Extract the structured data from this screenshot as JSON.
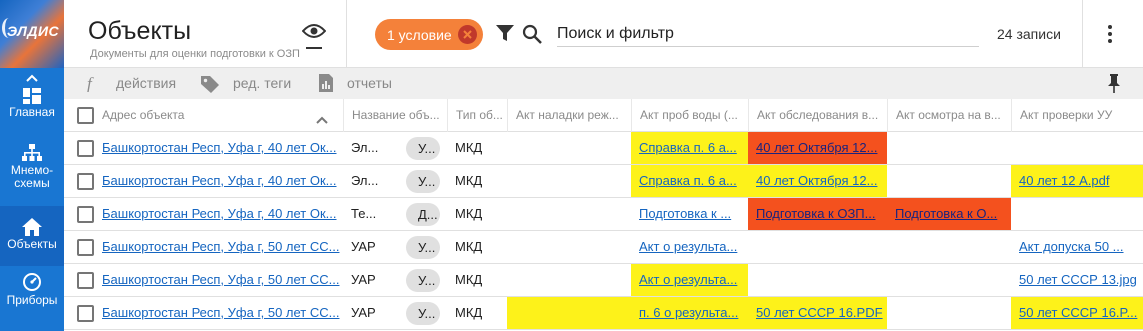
{
  "logo": {
    "text": "ЭЛДИС"
  },
  "rail": {
    "items": [
      {
        "label": "Главная",
        "icon": "dashboard-icon"
      },
      {
        "label": "Мнемо-",
        "label2": "схемы",
        "icon": "hierarchy-icon"
      },
      {
        "label": "Объекты",
        "icon": "home-icon",
        "active": true
      },
      {
        "label": "Приборы",
        "icon": "gauge-icon"
      }
    ]
  },
  "header": {
    "title": "Объекты",
    "subtitle": "Документы для оценки подготовки к ОЗП",
    "filter_chip": "1 условие",
    "search_placeholder": "Поиск и фильтр",
    "records": "24 записи"
  },
  "toolbar": {
    "actions": "действия",
    "tags": "ред. теги",
    "reports": "отчеты"
  },
  "table": {
    "columns": [
      "Адрес объекта",
      "Название объ...",
      "Тип об...",
      "Акт наладки реж...",
      "Акт проб воды (...",
      "Акт обследования в...",
      "Акт осмотра на в...",
      "Акт проверки УУ"
    ],
    "rows": [
      {
        "address": "Башкортостан Респ, Уфа г, 40 лет Ок...",
        "name": "Эл...",
        "pill": "У...",
        "type": "МКД",
        "c4": "",
        "c5": "Справка п. 6 а...",
        "c6": "40 лет Октября 12...",
        "c7": "",
        "c8": ""
      },
      {
        "address": "Башкортостан Респ, Уфа г, 40 лет Ок...",
        "name": "Эл...",
        "pill": "У...",
        "type": "МКД",
        "c4": "",
        "c5": "Справка п. 6 а...",
        "c6": "40 лет Октября 12...",
        "c7": "",
        "c8": "40 лет 12 А.pdf"
      },
      {
        "address": "Башкортостан Респ, Уфа г, 40 лет Ок...",
        "name": "Те...",
        "pill": "Д...",
        "type": "МКД",
        "c4": "",
        "c5": "Подготовка к ...",
        "c6": "Подготовка к ОЗП...",
        "c7": "Подготовка к О...",
        "c8": ""
      },
      {
        "address": "Башкортостан Респ, Уфа г, 50 лет СС...",
        "name": "УАР",
        "pill": "У...",
        "type": "МКД",
        "c4": "",
        "c5": "Акт о результа...",
        "c6": "",
        "c7": "",
        "c8": "Акт допуска 50 ..."
      },
      {
        "address": "Башкортостан Респ, Уфа г, 50 лет СС...",
        "name": "УАР",
        "pill": "У...",
        "type": "МКД",
        "c4": "",
        "c5": "Акт о результа...",
        "c6": "",
        "c7": "",
        "c8": "50 лет СССР 13.jpg"
      },
      {
        "address": "Башкортостан Респ, Уфа г, 50 лет СС...",
        "name": "УАР",
        "pill": "У...",
        "type": "МКД",
        "c4": "",
        "c5": "п. 6 о результа...",
        "c6": "50 лет СССР 16.PDF",
        "c7": "",
        "c8": "50 лет СССР 16.P..."
      }
    ]
  },
  "colors": {
    "rail": "#1976d2",
    "chip": "#f4813a",
    "highlight_yellow": "#fdf21a",
    "highlight_red": "#f4511e"
  }
}
